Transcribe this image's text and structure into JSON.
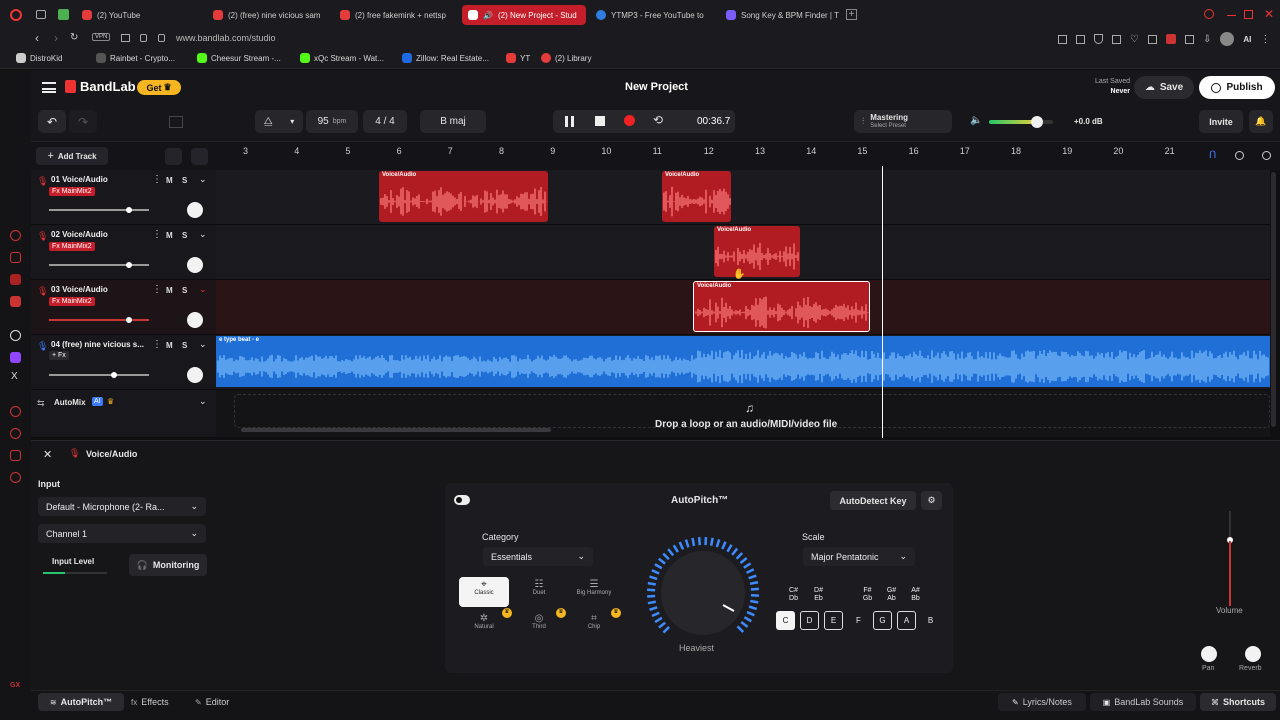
{
  "browser": {
    "tabs": [
      {
        "label": "(2) YouTube",
        "color": "#e43b3b"
      },
      {
        "label": "(2) (free) nine vicious sam",
        "color": "#e43b3b"
      },
      {
        "label": "(2) free fakemink + nettsp",
        "color": "#e43b3b"
      },
      {
        "label": "(2) New Project - Stud",
        "color": "#ffffff"
      },
      {
        "label": "YTMP3 - Free YouTube to",
        "color": "#2f7de1"
      },
      {
        "label": "Song Key & BPM Finder | T",
        "color": "#7a5cff"
      }
    ],
    "url": "www.bandlab.com/studio",
    "bookmarks": [
      "DistroKid",
      "Rainbet - Crypto...",
      "Cheesur Stream -...",
      "xQc Stream - Wat...",
      "Zillow: Real Estate...",
      "YT",
      "(2) Library"
    ]
  },
  "header": {
    "logo": "BandLab",
    "get": "Get",
    "title": "New Project",
    "last_saved_label": "Last Saved",
    "last_saved_value": "Never",
    "save": "Save",
    "publish": "Publish"
  },
  "transport": {
    "bpm": "95",
    "bpm_unit": "bpm",
    "time_sig": "4 / 4",
    "key": "B maj",
    "time": "00:36.7",
    "mastering": "Mastering",
    "mastering_sub": "Select Preset",
    "volume_db": "+0.0 dB",
    "invite": "Invite",
    "volume_level": 0.75
  },
  "timeline": {
    "add_track": "Add Track",
    "bars": [
      "3",
      "4",
      "5",
      "6",
      "7",
      "8",
      "9",
      "10",
      "11",
      "12",
      "13",
      "14",
      "15",
      "16",
      "17",
      "18",
      "19",
      "20",
      "21"
    ],
    "drop_text": "Drop a loop or an audio/MIDI/video file"
  },
  "tracks": [
    {
      "name": "01 Voice/Audio",
      "fx": "Fx MainMix2",
      "mute": "M",
      "solo": "S",
      "level": 0.8
    },
    {
      "name": "02 Voice/Audio",
      "fx": "Fx MainMix2",
      "mute": "M",
      "solo": "S",
      "level": 0.8
    },
    {
      "name": "03 Voice/Audio",
      "fx": "Fx MainMix2",
      "mute": "M",
      "solo": "S",
      "level": 0.8
    },
    {
      "name": "04 (free) nine vicious s...",
      "fx": "+ Fx",
      "mute": "M",
      "solo": "S",
      "level": 0.65
    }
  ],
  "clips": {
    "voice": "Voice/Audio",
    "beat": "e type beat - e"
  },
  "automix": {
    "label": "AutoMix",
    "badge": "AI"
  },
  "panel": {
    "track_title": "Voice/Audio",
    "input_label": "Input",
    "input_device": "Default - Microphone (2- Ra...",
    "channel": "Channel 1",
    "input_level": "Input Level",
    "monitoring": "Monitoring",
    "autopitch_title": "AutoPitch™",
    "autodetect": "AutoDetect Key",
    "category_label": "Category",
    "category_value": "Essentials",
    "categories": [
      "Classic",
      "Duet",
      "Big Harmony",
      "Natural",
      "Third",
      "Chip"
    ],
    "knob_label": "Heaviest",
    "scale_label": "Scale",
    "scale_value": "Major Pentatonic",
    "sharps": [
      "C# Db",
      "D# Eb",
      "F# Gb",
      "G# Ab",
      "A# Bb"
    ],
    "naturals": [
      "C",
      "D",
      "E",
      "F",
      "G",
      "A",
      "B"
    ],
    "volume": "Volume",
    "pan": "Pan",
    "reverb": "Reverb"
  },
  "bottom": {
    "autopitch": "AutoPitch™",
    "effects": "Effects",
    "editor": "Editor",
    "lyrics": "Lyrics/Notes",
    "sounds": "BandLab Sounds",
    "shortcuts": "Shortcuts"
  }
}
